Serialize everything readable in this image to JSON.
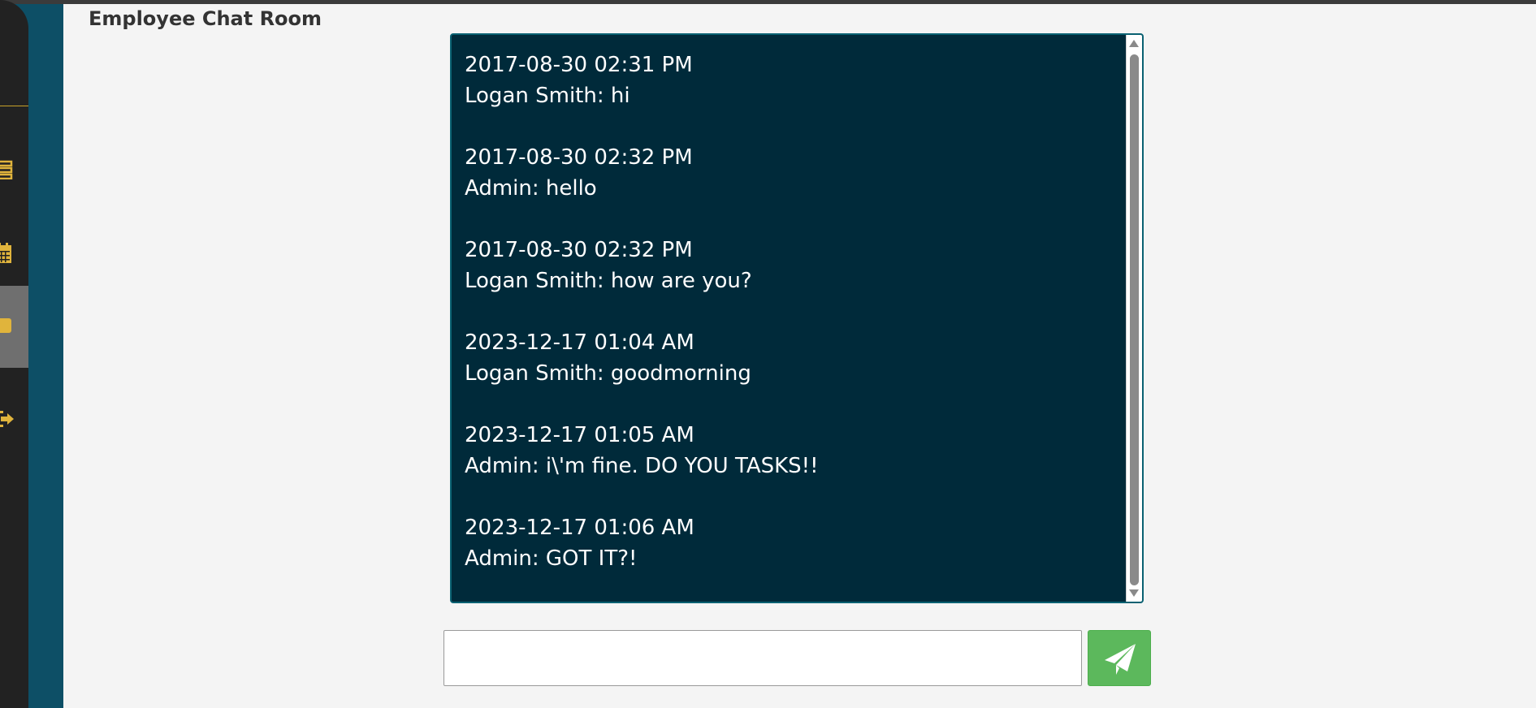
{
  "page": {
    "title": "Employee Chat Room"
  },
  "sidebar": {
    "items": [
      {
        "icon": "list-icon",
        "active": false
      },
      {
        "icon": "calendar-icon",
        "active": false
      },
      {
        "icon": "chat-icon",
        "active": true
      },
      {
        "icon": "sign-out-icon",
        "active": false
      }
    ],
    "accent_color": "#e0b43c"
  },
  "chat": {
    "messages": [
      {
        "timestamp": "2017-08-30 02:31 PM",
        "text": "Logan Smith: hi"
      },
      {
        "timestamp": "2017-08-30 02:32 PM",
        "text": "Admin: hello"
      },
      {
        "timestamp": "2017-08-30 02:32 PM",
        "text": "Logan Smith: how are you?"
      },
      {
        "timestamp": "2023-12-17 01:04 AM",
        "text": "Logan Smith: goodmorning"
      },
      {
        "timestamp": "2023-12-17 01:05 AM",
        "text": "Admin: i\\'m fine. DO YOU TASKS!!"
      },
      {
        "timestamp": "2023-12-17 01:06 AM",
        "text": "Admin: GOT IT?!"
      }
    ],
    "background_color": "#002a3a"
  },
  "composer": {
    "input_value": "",
    "input_placeholder": "",
    "send_icon": "paper-plane-icon",
    "send_color": "#5cb85c"
  }
}
